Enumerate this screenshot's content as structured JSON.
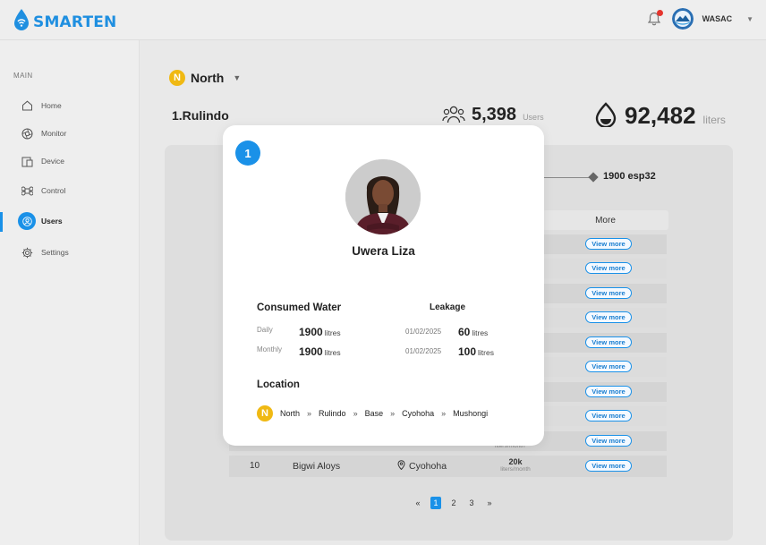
{
  "app": {
    "brand": "SMARTEN",
    "org_name": "WASAC",
    "accent": "#1a91e8"
  },
  "sidebar": {
    "section": "MAIN",
    "items": [
      {
        "label": "Home",
        "icon": "home-icon"
      },
      {
        "label": "Monitor",
        "icon": "aperture-icon"
      },
      {
        "label": "Device",
        "icon": "devices-icon"
      },
      {
        "label": "Control",
        "icon": "command-icon"
      },
      {
        "label": "Users",
        "icon": "user-icon",
        "active": true
      },
      {
        "label": "Settings",
        "icon": "gear-icon"
      }
    ]
  },
  "header": {
    "region_badge": "N",
    "region": "North",
    "area": "1.Rulindo",
    "users_count": "5,398",
    "users_unit": "Users",
    "liters_count": "92,482",
    "liters_unit": "liters"
  },
  "device": {
    "label": "1900 esp32"
  },
  "table": {
    "more_header": "More",
    "view_more": "View more",
    "last_row": {
      "index": "10",
      "name": "Bigwi Aloys",
      "location": "Cyohoha",
      "value": "20k",
      "unit": "liters/month"
    },
    "partial_unit": "liters/month"
  },
  "pagination": {
    "prev": "«",
    "pages": [
      "1",
      "2",
      "3"
    ],
    "active": "1",
    "next": "»"
  },
  "modal": {
    "badge": "1",
    "name": "Uwera Liza",
    "consumed": {
      "title": "Consumed Water",
      "daily_label": "Daily",
      "daily_value": "1900",
      "monthly_label": "Monthly",
      "monthly_value": "1900",
      "unit": "litres"
    },
    "leakage": {
      "title": "Leakage",
      "entries": [
        {
          "date": "01/02/2025",
          "value": "60",
          "unit": "litres"
        },
        {
          "date": "01/02/2025",
          "value": "100",
          "unit": "litres"
        }
      ]
    },
    "location": {
      "title": "Location",
      "badge": "N",
      "path": [
        "North",
        "Rulindo",
        "Base",
        "Cyohoha",
        "Mushongi"
      ],
      "sep": "»"
    }
  }
}
